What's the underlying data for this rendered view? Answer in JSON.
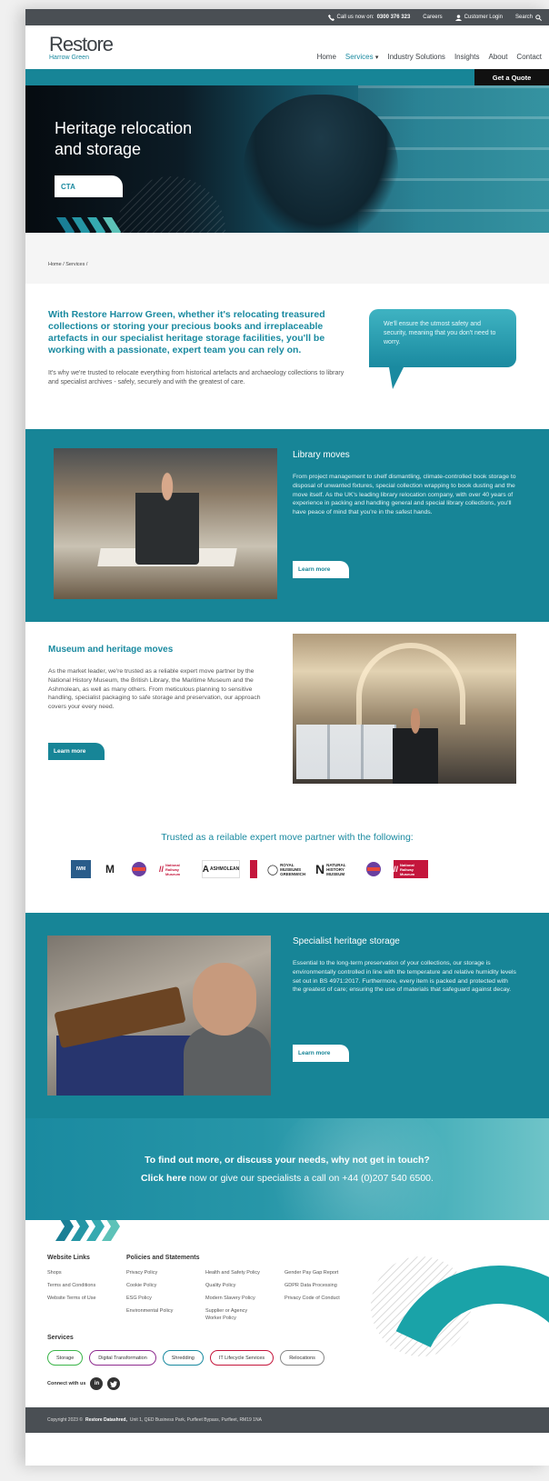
{
  "topbar": {
    "call_label": "Call us now on:",
    "phone": "0300 376 323",
    "careers": "Careers",
    "customer_login": "Customer Login",
    "search": "Search"
  },
  "header": {
    "logo_main": "Restore",
    "logo_sub": "Harrow Green",
    "nav": [
      "Home",
      "Services",
      "Industry Solutions",
      "Insights",
      "About",
      "Contact"
    ],
    "active_nav": "Services",
    "quote_button": "Get a Quote"
  },
  "hero": {
    "title_line1": "Heritage relocation",
    "title_line2": "and storage",
    "cta": "CTA"
  },
  "breadcrumb": "Home / Services /",
  "intro": {
    "lead": "With Restore Harrow Green, whether it's relocating treasured collections or storing your precious books and irreplaceable artefacts in our specialist heritage storage facilities, you'll be working with a passionate, expert team you can rely on.",
    "body": "It's why we're trusted to relocate everything from historical artefacts and archaeology collections to library and specialist archives - safely, securely and with the greatest of care.",
    "bubble": "We'll ensure the utmost safety and security, meaning that you don't need to worry."
  },
  "library": {
    "title": "Library moves",
    "body": "From project management to shelf dismantling, climate-controlled book storage to disposal of unwanted fixtures, special collection wrapping to book dusting and the move itself.  As the UK's leading library relocation company, with over 40 years of experience in packing and handling general and special library collections, you'll have peace of mind that you're in the safest hands.",
    "button": "Learn more"
  },
  "museum": {
    "title": "Museum and heritage moves",
    "body": "As the market leader, we're trusted as a reliable expert move partner by the National History Museum, the British Library, the Maritime Museum and the Ashmolean, as well as many others.  From meticulous planning to sensitive handling, specialist packaging to safe storage and preservation, our approach covers your every need.",
    "button": "Learn more"
  },
  "trusted": {
    "title": "Trusted as a reilable expert move partner with the following:",
    "logos": [
      "IWM",
      "M",
      "",
      "National Railway Museum",
      "ASHMOLEAN",
      "",
      "ROYAL MUSEUMS GREENWICH",
      "NATURAL HISTORY MUSEUM",
      "",
      "National Railway Museum"
    ]
  },
  "storage": {
    "title": "Specialist heritage storage",
    "body": "Essential to the long-term preservation of your collections, our storage is environmentally controlled in line with the temperature and relative humidity levels set out in BS 4971:2017.  Furthermore, every item is packed and protected with the greatest of care; ensuring the use of materials that safeguard against decay.",
    "button": "Learn more"
  },
  "contact": {
    "question": "To find out more, or discuss your needs, why not get in touch?",
    "link": "Click here",
    "rest": " now or give our specialists a call on +44 (0)207 540 6500."
  },
  "footer": {
    "website_links_title": "Website Links",
    "website_links": [
      "Shops",
      "Terms and Conditions",
      "Website Terms of Use"
    ],
    "policies_title": "Policies and Statements",
    "policies_col1": [
      "Privacy Policy",
      "Cookie Policy",
      "ESG Policy",
      "Environmental Policy"
    ],
    "policies_col2": [
      "Health and Safety Policy",
      "Quality Policy",
      "Modern Slavery Policy",
      "Supplier or Agency Worker Policy"
    ],
    "policies_col3": [
      "Gender Pay Gap Report",
      "GDPR Data Processing",
      "Privacy Code of Conduct"
    ],
    "services_title": "Services",
    "services": [
      {
        "label": "Storage",
        "color": "#3bb54a"
      },
      {
        "label": "Digital Transformation",
        "color": "#8e2c8f"
      },
      {
        "label": "Shredding",
        "color": "#1a8aa0"
      },
      {
        "label": "IT Lifecycle Services",
        "color": "#c4163c"
      },
      {
        "label": "Relocations",
        "color": "#888888"
      }
    ],
    "connect": "Connect with us",
    "copyright_pre": "Copyright 2023 ©",
    "copyright_brand": "Restore Datashred,",
    "copyright_addr": "Unit 1, QED Business Park, Purfleet Bypass, Purfleet, RM19 1NA"
  },
  "colors": {
    "teal": "#178597",
    "teal_light": "#1a8aa0",
    "chevron_1": "#1a7f96",
    "chevron_2": "#2596a5",
    "chevron_3": "#35aab0",
    "chevron_4": "#5dc2b8",
    "dark_bar": "#4a4f54"
  }
}
